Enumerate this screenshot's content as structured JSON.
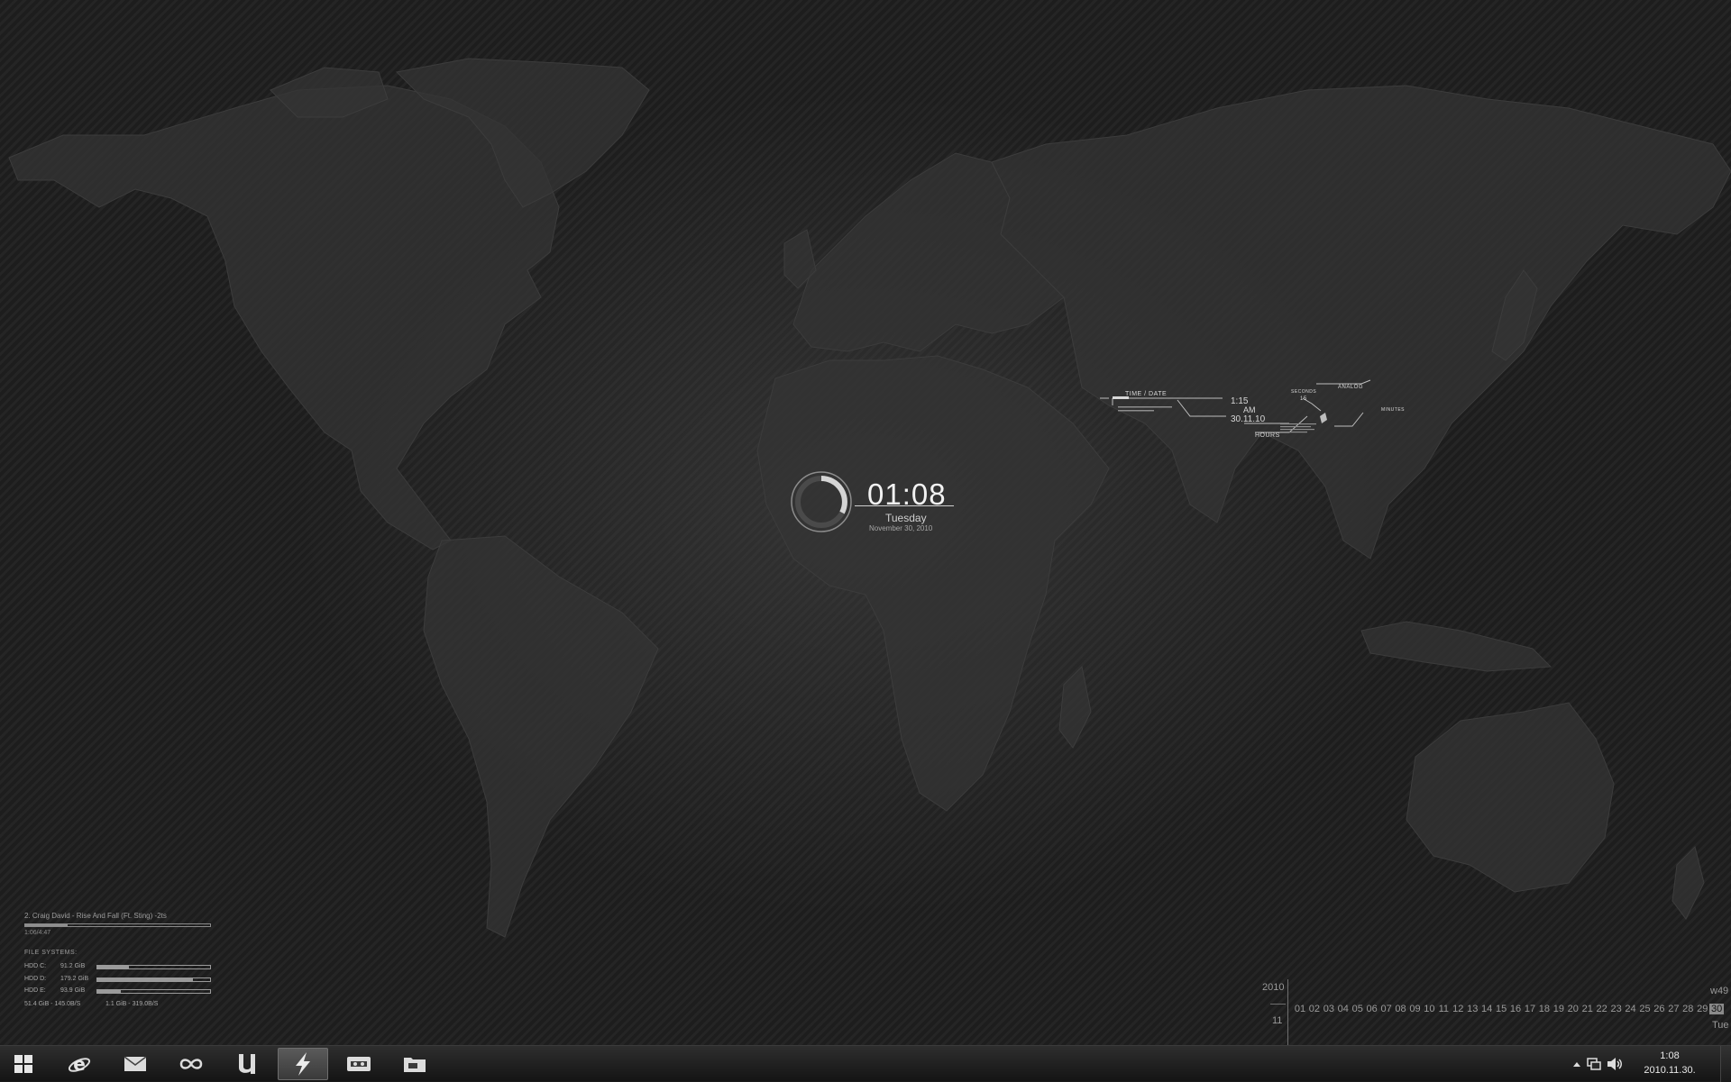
{
  "desktop": {
    "clock": {
      "time": "01:08",
      "day": "Tuesday",
      "date": "November 30, 2010"
    },
    "hud": {
      "title": "TIME / DATE",
      "time": "1:15",
      "ampm": "AM",
      "date": "30.11.10",
      "seconds_label": "SECONDS",
      "seconds_value": "15",
      "analog_label": "ANALOG",
      "minutes_label": "MINUTES",
      "hours_label": "HOURS"
    },
    "music": {
      "title": "2. Craig David - Rise And Fall (Ft. Sting) -2ts",
      "time": "1:06/4:47",
      "progress": 0.23
    },
    "file_systems": {
      "title": "FILE SYSTEMS:",
      "drives": [
        {
          "label": "HDD C:",
          "size": "91.2 GiB",
          "used": 0.28
        },
        {
          "label": "HDD D:",
          "size": "179.2 GiB",
          "used": 0.85
        },
        {
          "label": "HDD E:",
          "size": "93.9 GiB",
          "used": 0.21
        }
      ],
      "read": "51.4 GiB - 145.0B/S",
      "write": "1.1 GiB - 319.0B/S"
    },
    "calendar": {
      "year": "2010",
      "month": "11",
      "week": "w49",
      "weekday": "Tue",
      "today": "30",
      "days": [
        "01",
        "02",
        "03",
        "04",
        "05",
        "06",
        "07",
        "08",
        "09",
        "10",
        "11",
        "12",
        "13",
        "14",
        "15",
        "16",
        "17",
        "18",
        "19",
        "20",
        "21",
        "22",
        "23",
        "24",
        "25",
        "26",
        "27",
        "28",
        "29",
        "30"
      ]
    }
  },
  "taskbar": {
    "buttons": [
      {
        "name": "start-button",
        "icon": "windows-logo-icon"
      },
      {
        "name": "internet-explorer-button",
        "icon": "internet-explorer-icon"
      },
      {
        "name": "mail-button",
        "icon": "envelope-icon"
      },
      {
        "name": "network-button",
        "icon": "infinity-link-icon"
      },
      {
        "name": "utorrent-button",
        "icon": "utorrent-icon"
      },
      {
        "name": "winamp-button",
        "icon": "lightning-bolt-icon",
        "active": true
      },
      {
        "name": "media-button",
        "icon": "film-reel-icon"
      },
      {
        "name": "explorer-button",
        "icon": "folder-icon"
      }
    ],
    "tray": {
      "time": "1:08",
      "date": "2010.11.30."
    }
  }
}
